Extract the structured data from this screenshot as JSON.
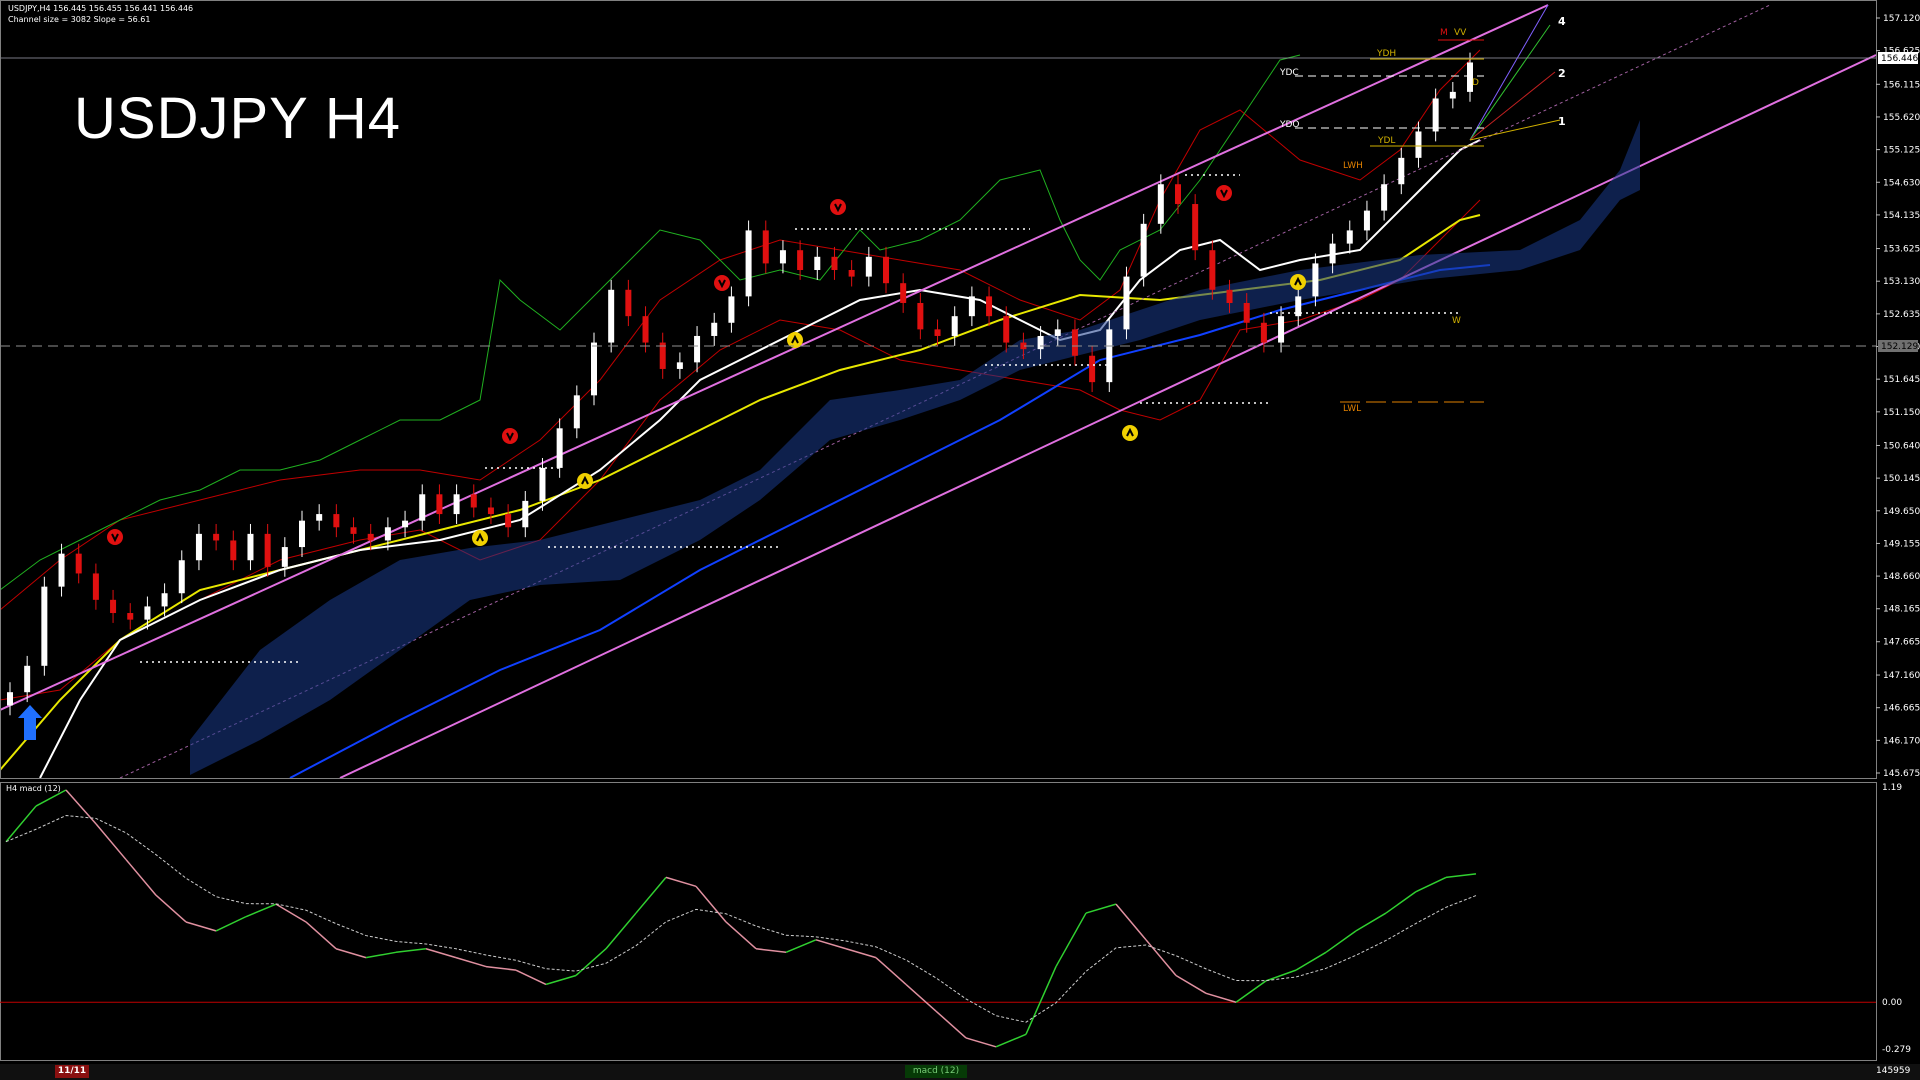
{
  "header": {
    "symbol_line": "USDJPY,H4  156.445 156.455 156.441 156.446",
    "channel_line": "Channel size = 3082 Slope = 56.61"
  },
  "title": "USDJPY H4",
  "subwindow_label": "H4  macd (12)",
  "price_axis_labels": [
    "157.120",
    "156.625",
    "156.115",
    "155.620",
    "155.125",
    "154.630",
    "154.135",
    "153.625",
    "153.130",
    "152.635",
    "152.140",
    "151.645",
    "151.150",
    "150.640",
    "150.145",
    "149.650",
    "149.155",
    "148.660",
    "148.165",
    "147.665",
    "147.160",
    "146.665",
    "146.170",
    "145.675"
  ],
  "price_axis_values": [
    157.12,
    156.625,
    156.115,
    155.62,
    155.125,
    154.63,
    154.135,
    153.625,
    153.13,
    152.635,
    152.14,
    151.645,
    151.15,
    150.64,
    150.145,
    149.65,
    149.155,
    148.66,
    148.165,
    147.665,
    147.16,
    146.665,
    146.17,
    145.675
  ],
  "current_price": "156.446",
  "dashed_level": "152.129",
  "macd_axis": {
    "top": "1.19",
    "zero": "0.00",
    "bottom": "-0.279"
  },
  "level_labels": [
    "YDH",
    "YDC",
    "YDO",
    "YDL",
    "LWH",
    "LWL",
    "M",
    "W",
    "D",
    "VV"
  ],
  "channel_labels": [
    "4",
    "2",
    "1"
  ],
  "bottom_bar": {
    "date": "11/11",
    "tab": "macd (12)",
    "number": "145959"
  },
  "colors": {
    "bull": "#ffffff",
    "bear": "#e01010",
    "channel": "#e070e0",
    "ma_white": "#ffffff",
    "ma_yellow": "#e8e800",
    "ma_blue": "#1040ff",
    "bands": "#c00000",
    "cloud": "#1a3a8a",
    "macd_up": "#30d030",
    "macd_down": "#e090a0",
    "signal": "#cccccc",
    "fractal_up": "#f0d000",
    "fractal_down": "#e01010"
  },
  "chart_data": {
    "type": "line",
    "title": "USDJPY H4",
    "ylim": [
      145.675,
      157.12
    ],
    "series": [
      {
        "name": "close",
        "values": [
          146.9,
          147.3,
          148.5,
          149.0,
          148.7,
          148.3,
          148.1,
          148.0,
          148.2,
          148.4,
          148.9,
          149.3,
          149.2,
          148.9,
          149.3,
          148.8,
          149.1,
          149.5,
          149.6,
          149.4,
          149.3,
          149.2,
          149.4,
          149.5,
          149.9,
          149.6,
          149.9,
          149.7,
          149.6,
          149.4,
          149.8,
          150.3,
          150.9,
          151.4,
          152.2,
          153.0,
          152.6,
          152.2,
          151.8,
          151.9,
          152.3,
          152.5,
          152.9,
          153.9,
          153.4,
          153.6,
          153.3,
          153.5,
          153.3,
          153.2,
          153.5,
          153.1,
          152.8,
          152.4,
          152.3,
          152.6,
          152.9,
          152.6,
          152.2,
          152.1,
          152.3,
          152.4,
          152.0,
          151.6,
          152.4,
          153.2,
          154.0,
          154.6,
          154.3,
          153.6,
          153.0,
          152.8,
          152.5,
          152.2,
          152.6,
          152.9,
          153.4,
          153.7,
          153.9,
          154.2,
          154.6,
          155.0,
          155.4,
          155.9,
          156.0,
          156.446
        ]
      },
      {
        "name": "macd",
        "values": [
          0.9,
          1.1,
          1.19,
          1.0,
          0.8,
          0.6,
          0.45,
          0.4,
          0.48,
          0.55,
          0.45,
          0.3,
          0.25,
          0.28,
          0.3,
          0.25,
          0.2,
          0.18,
          0.1,
          0.15,
          0.3,
          0.5,
          0.7,
          0.65,
          0.45,
          0.3,
          0.28,
          0.35,
          0.3,
          0.25,
          0.1,
          -0.05,
          -0.2,
          -0.25,
          -0.18,
          0.2,
          0.5,
          0.55,
          0.35,
          0.15,
          0.05,
          0.0,
          0.12,
          0.18,
          0.28,
          0.4,
          0.5,
          0.62,
          0.7,
          0.72
        ]
      }
    ]
  }
}
